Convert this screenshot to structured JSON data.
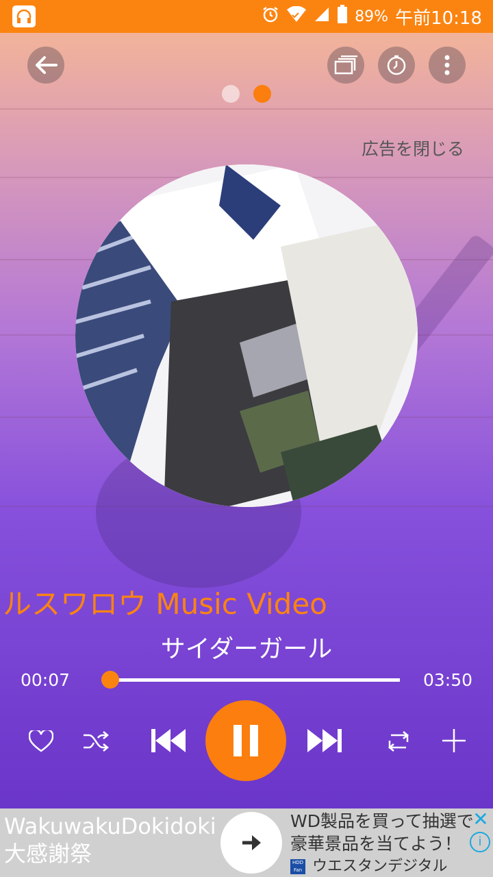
{
  "status_bar": {
    "battery": "89%",
    "time": "午前10:18"
  },
  "header": {
    "close_ad": "広告を閉じる",
    "page_indicator": {
      "total": 2,
      "current": 2
    }
  },
  "track": {
    "title": "ルスワロウ Music Video",
    "artist": "サイダーガール",
    "elapsed": "00:07",
    "duration": "03:50",
    "progress": 0.03
  },
  "ad": {
    "left_line1": "WakuwakuDokidoki",
    "left_line2": "大感謝祭",
    "right_line1": "WD製品を買って抽選で",
    "right_line2": "豪華景品を当てよう！",
    "brand": "ウエスタンデジタル",
    "logo_text": "HDD Fan",
    "close_icon": "✕",
    "info_icon": "i"
  },
  "colors": {
    "accent": "#fb8411",
    "background": "#6a35c9",
    "status_bar": "#fb8411"
  }
}
